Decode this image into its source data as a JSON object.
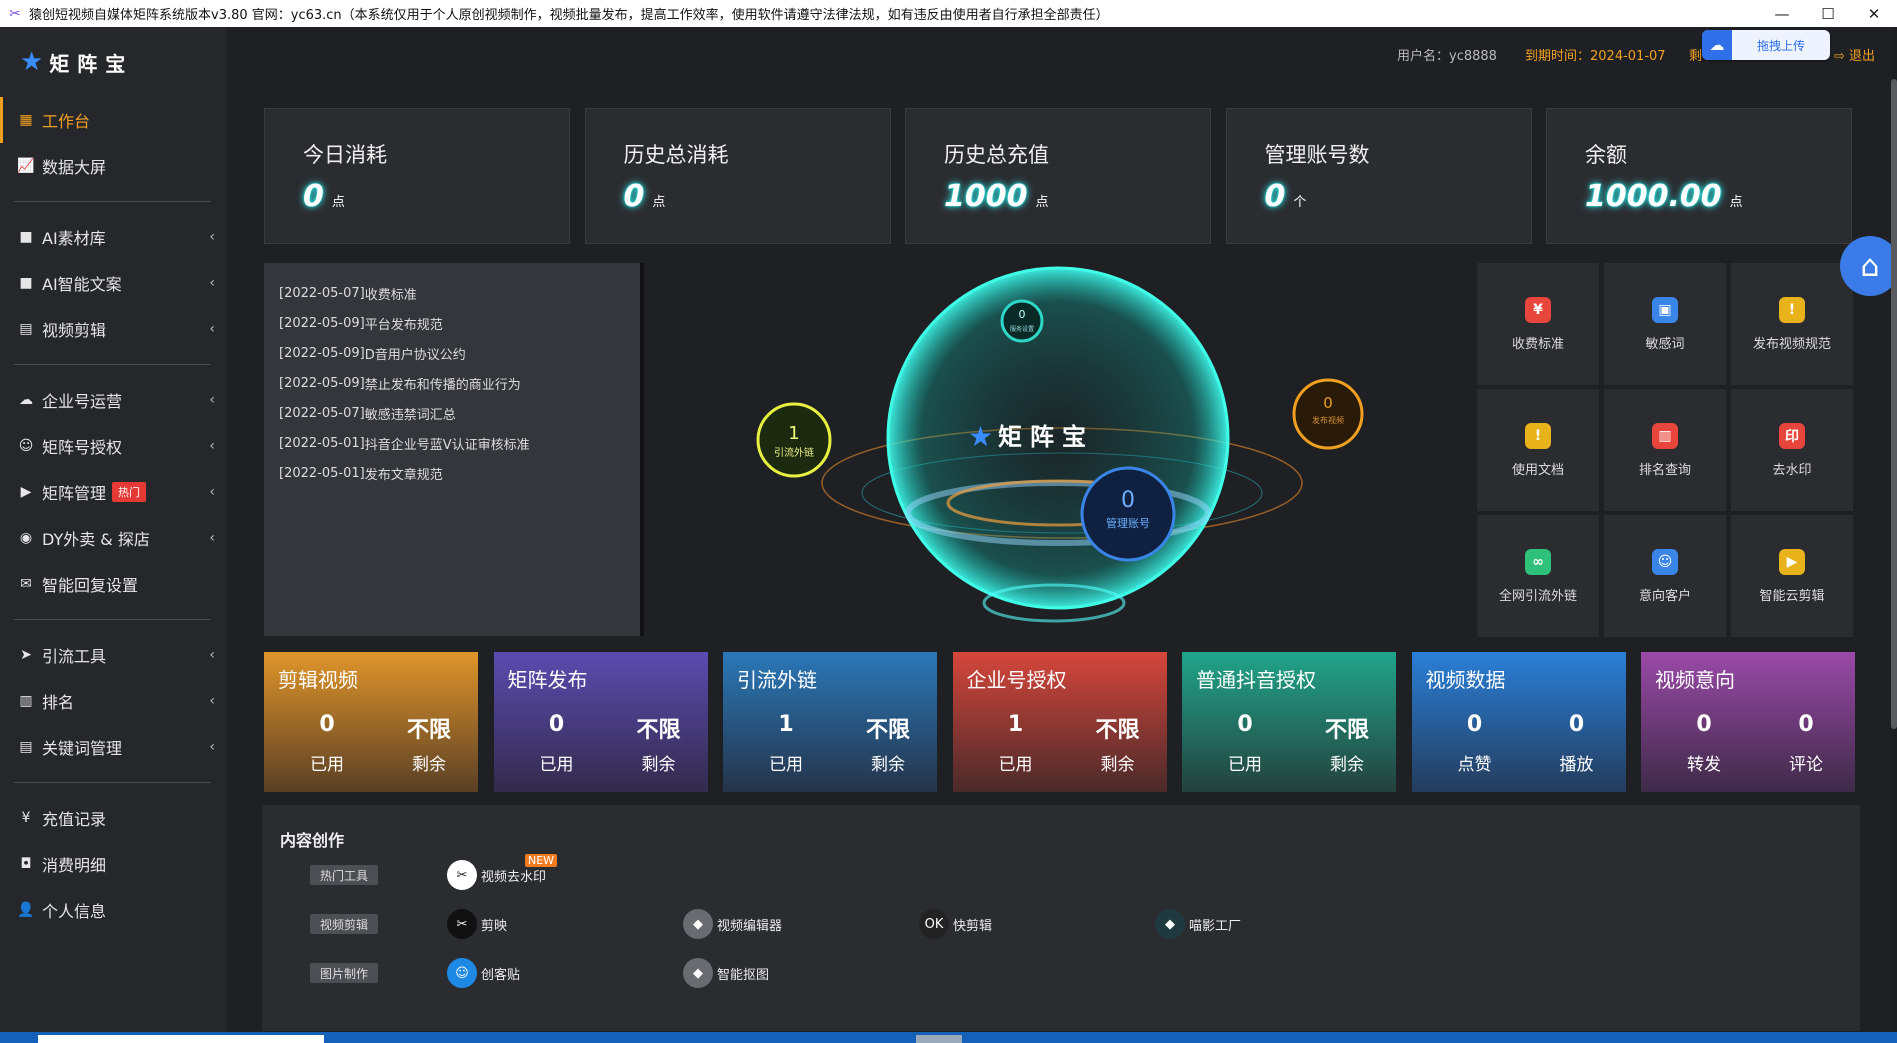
{
  "window": {
    "title": "猿创短视频自媒体矩阵系统版本v3.80 官网：yc63.cn（本系统仅用于个人原创视频制作，视频批量发布，提高工作效率，使用软件请遵守法律法规，如有违反由使用者自行承担全部责任）",
    "controls": {
      "minimize": "—",
      "maximize": "☐",
      "close": "✕"
    }
  },
  "brand": {
    "name": "矩阵宝",
    "icon": "★"
  },
  "sidebar": {
    "items": [
      {
        "label": "工作台",
        "icon": "▦",
        "active": true
      },
      {
        "label": "数据大屏",
        "icon": "📈"
      },
      {
        "label": "AI素材库",
        "icon": "■",
        "chevron": "‹"
      },
      {
        "label": "AI智能文案",
        "icon": "■",
        "chevron": "‹"
      },
      {
        "label": "视频剪辑",
        "icon": "▤",
        "chevron": "‹"
      },
      {
        "label": "企业号运营",
        "icon": "☁",
        "chevron": "‹"
      },
      {
        "label": "矩阵号授权",
        "icon": "☺",
        "chevron": "‹"
      },
      {
        "label": "矩阵管理",
        "icon": "▶",
        "chevron": "‹",
        "badge": "热门"
      },
      {
        "label": "DY外卖 & 探店",
        "icon": "◉",
        "chevron": "‹"
      },
      {
        "label": "智能回复设置",
        "icon": "✉"
      },
      {
        "label": "引流工具",
        "icon": "➤",
        "chevron": "‹"
      },
      {
        "label": "排名",
        "icon": "▥",
        "chevron": "‹"
      },
      {
        "label": "关键词管理",
        "icon": "▤",
        "chevron": "‹"
      },
      {
        "label": "充值记录",
        "icon": "¥"
      },
      {
        "label": "消费明细",
        "icon": "◘"
      },
      {
        "label": "个人信息",
        "icon": "👤"
      }
    ]
  },
  "topbar": {
    "user": "用户名：yc8888",
    "expire": "到期时间：2024-01-07",
    "left_clip": "剩",
    "logout": "退出",
    "upload_label": "拖拽上传"
  },
  "summary_cards": [
    {
      "title": "今日消耗",
      "value": "0",
      "unit": "点"
    },
    {
      "title": "历史总消耗",
      "value": "0",
      "unit": "点"
    },
    {
      "title": "历史总充值",
      "value": "1000",
      "unit": "点"
    },
    {
      "title": "管理账号数",
      "value": "0",
      "unit": "个"
    },
    {
      "title": "余额",
      "value": "1000.00",
      "unit": "点"
    }
  ],
  "notices": [
    {
      "date": "[2022-05-07]",
      "text": "收费标准"
    },
    {
      "date": "[2022-05-09]",
      "text": "平台发布规范"
    },
    {
      "date": "[2022-05-09]",
      "text": "D音用户协议公约"
    },
    {
      "date": "[2022-05-09]",
      "text": "禁止发布和传播的商业行为"
    },
    {
      "date": "[2022-05-07]",
      "text": "敏感违禁词汇总"
    },
    {
      "date": "[2022-05-01]",
      "text": "抖音企业号蓝V认证审核标准"
    },
    {
      "date": "[2022-05-01]",
      "text": "发布文章规范"
    }
  ],
  "orbit": {
    "logo": "矩阵宝",
    "top": {
      "value": "0",
      "label": "服务设置"
    },
    "left": {
      "value": "1",
      "label": "引流外链"
    },
    "right": {
      "value": "0",
      "label": "发布视频"
    },
    "center": {
      "value": "0",
      "label": "管理账号"
    }
  },
  "tool_tiles": [
    {
      "label": "收费标准",
      "glyph": "¥",
      "color": "#e8453c"
    },
    {
      "label": "敏感词",
      "glyph": "▣",
      "color": "#3a86e8"
    },
    {
      "label": "发布视频规范",
      "glyph": "!",
      "color": "#e8b21a"
    },
    {
      "label": "使用文档",
      "glyph": "!",
      "color": "#e8b21a"
    },
    {
      "label": "排名查询",
      "glyph": "▥",
      "color": "#e8453c"
    },
    {
      "label": "去水印",
      "glyph": "印",
      "color": "#e8453c"
    },
    {
      "label": "全网引流外链",
      "glyph": "∞",
      "color": "#2fc07a"
    },
    {
      "label": "意向客户",
      "glyph": "☺",
      "color": "#3a86e8"
    },
    {
      "label": "智能云剪辑",
      "glyph": "▶",
      "color": "#e8b21a"
    }
  ],
  "stat_cards": [
    {
      "title": "剪辑视频",
      "v1": "0",
      "l1": "已用",
      "v2": "不限",
      "l2": "剩余",
      "colors": [
        "#e0952a",
        "#5a3f24"
      ]
    },
    {
      "title": "矩阵发布",
      "v1": "0",
      "l1": "已用",
      "v2": "不限",
      "l2": "剩余",
      "colors": [
        "#5b4bb0",
        "#322b4c"
      ]
    },
    {
      "title": "引流外链",
      "v1": "1",
      "l1": "已用",
      "v2": "不限",
      "l2": "剩余",
      "colors": [
        "#2a78b8",
        "#24344a"
      ]
    },
    {
      "title": "企业号授权",
      "v1": "1",
      "l1": "已用",
      "v2": "不限",
      "l2": "剩余",
      "colors": [
        "#d6463b",
        "#4a2a2a"
      ]
    },
    {
      "title": "普通抖音授权",
      "v1": "0",
      "l1": "已用",
      "v2": "不限",
      "l2": "剩余",
      "colors": [
        "#20a58a",
        "#23413d"
      ]
    },
    {
      "title": "视频数据",
      "v1": "0",
      "l1": "点赞",
      "v2": "0",
      "l2": "播放",
      "colors": [
        "#2a7fd8",
        "#243c5c"
      ]
    },
    {
      "title": "视频意向",
      "v1": "0",
      "l1": "转发",
      "v2": "0",
      "l2": "评论",
      "colors": [
        "#9a4aa8",
        "#3e2a48"
      ]
    }
  ],
  "content": {
    "title": "内容创作",
    "rows": [
      {
        "tag": "热门工具",
        "apps": [
          {
            "label": "视频去水印",
            "glyph": "✂",
            "color": "#ffffff",
            "new": "NEW"
          }
        ]
      },
      {
        "tag": "视频剪辑",
        "apps": [
          {
            "label": "剪映",
            "glyph": "✂",
            "color": "#111111"
          },
          {
            "label": "视频编辑器",
            "glyph": "◆",
            "color": "#6a6b70"
          },
          {
            "label": "快剪辑",
            "glyph": "OK",
            "color": "#222222"
          },
          {
            "label": "喵影工厂",
            "glyph": "◆",
            "color": "#1e3a40"
          }
        ]
      },
      {
        "tag": "图片制作",
        "apps": [
          {
            "label": "创客贴",
            "glyph": "☺",
            "color": "#1e88e5"
          },
          {
            "label": "智能抠图",
            "glyph": "◆",
            "color": "#6a6b70"
          }
        ]
      }
    ]
  }
}
